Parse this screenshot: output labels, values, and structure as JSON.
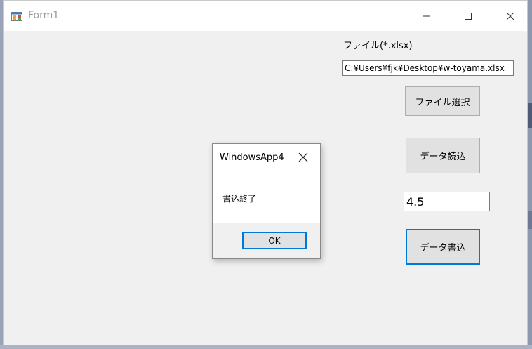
{
  "window": {
    "title": "Form1"
  },
  "form": {
    "file_label": "ファイル(*.xlsx)",
    "file_path_value": "C:¥Users¥fjk¥Desktop¥w-toyama.xlsx",
    "select_file_button": "ファイル選択",
    "read_data_button": "データ読込",
    "numeric_value": "4.5",
    "write_data_button": "データ書込"
  },
  "message_box": {
    "title": "WindowsApp4",
    "message": "書込終了",
    "ok_button": "OK"
  },
  "icons": {
    "app": "form-app-icon",
    "minimize": "minimize-icon",
    "maximize": "maximize-icon",
    "close": "close-icon"
  },
  "colors": {
    "accent_focus": "#0078d7",
    "window_bg": "#f0f0f0",
    "button_bg": "#e1e1e1"
  }
}
